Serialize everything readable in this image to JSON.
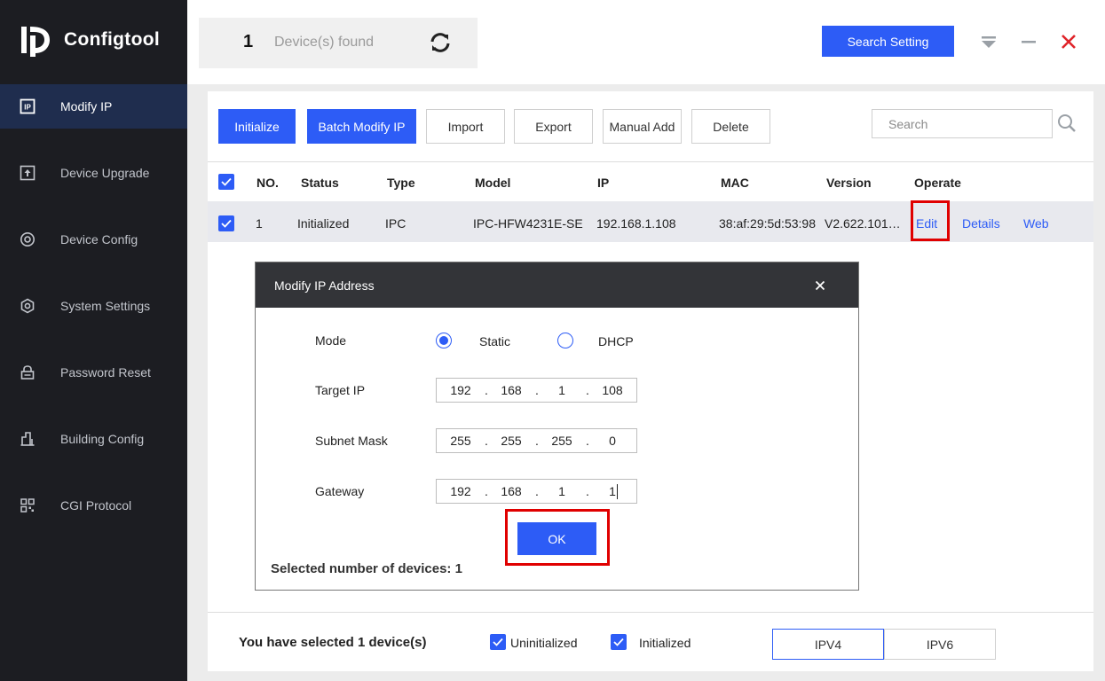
{
  "app": {
    "name": "Configtool"
  },
  "sidebar": {
    "items": [
      {
        "label": "Modify IP",
        "icon": "ip-icon",
        "active": true
      },
      {
        "label": "Device Upgrade",
        "icon": "upgrade-icon",
        "active": false
      },
      {
        "label": "Device Config",
        "icon": "config-icon",
        "active": false
      },
      {
        "label": "System Settings",
        "icon": "settings-icon",
        "active": false
      },
      {
        "label": "Password Reset",
        "icon": "lock-icon",
        "active": false
      },
      {
        "label": "Building Config",
        "icon": "building-icon",
        "active": false
      },
      {
        "label": "CGI Protocol",
        "icon": "qr-icon",
        "active": false
      }
    ]
  },
  "header": {
    "found_count": "1",
    "found_label": "Device(s) found",
    "search_setting_label": "Search Setting"
  },
  "toolbar": {
    "buttons": [
      "Initialize",
      "Batch Modify IP",
      "Import",
      "Export",
      "Manual Add",
      "Delete"
    ],
    "search_placeholder": "Search"
  },
  "table": {
    "columns": [
      "NO.",
      "Status",
      "Type",
      "Model",
      "IP",
      "MAC",
      "Version",
      "Operate"
    ],
    "rows": [
      {
        "no": "1",
        "status": "Initialized",
        "type": "IPC",
        "model": "IPC-HFW4231E-SE",
        "ip": "192.168.1.108",
        "mac": "38:af:29:5d:53:98",
        "version": "V2.622.101…",
        "actions": [
          "Edit",
          "Details",
          "Web"
        ],
        "checked": true
      }
    ]
  },
  "dialog": {
    "title": "Modify IP Address",
    "mode_label": "Mode",
    "mode_options": [
      "Static",
      "DHCP"
    ],
    "mode_selected": "Static",
    "target_ip_label": "Target IP",
    "target_ip": [
      "192",
      "168",
      "1",
      "108"
    ],
    "subnet_mask_label": "Subnet Mask",
    "subnet_mask": [
      "255",
      "255",
      "255",
      "0"
    ],
    "gateway_label": "Gateway",
    "gateway": [
      "192",
      "168",
      "1",
      "1"
    ],
    "ok_label": "OK",
    "selected_count_text": "Selected number of devices: 1"
  },
  "footer": {
    "selected_text": "You have selected 1  device(s)",
    "uninitialized_label": "Uninitialized",
    "initialized_label": "Initialized",
    "ipv4_label": "IPV4",
    "ipv6_label": "IPV6"
  },
  "colors": {
    "accent": "#2d5cf6",
    "sidebar_bg": "#1c1d22",
    "highlight_red": "#e00000"
  }
}
